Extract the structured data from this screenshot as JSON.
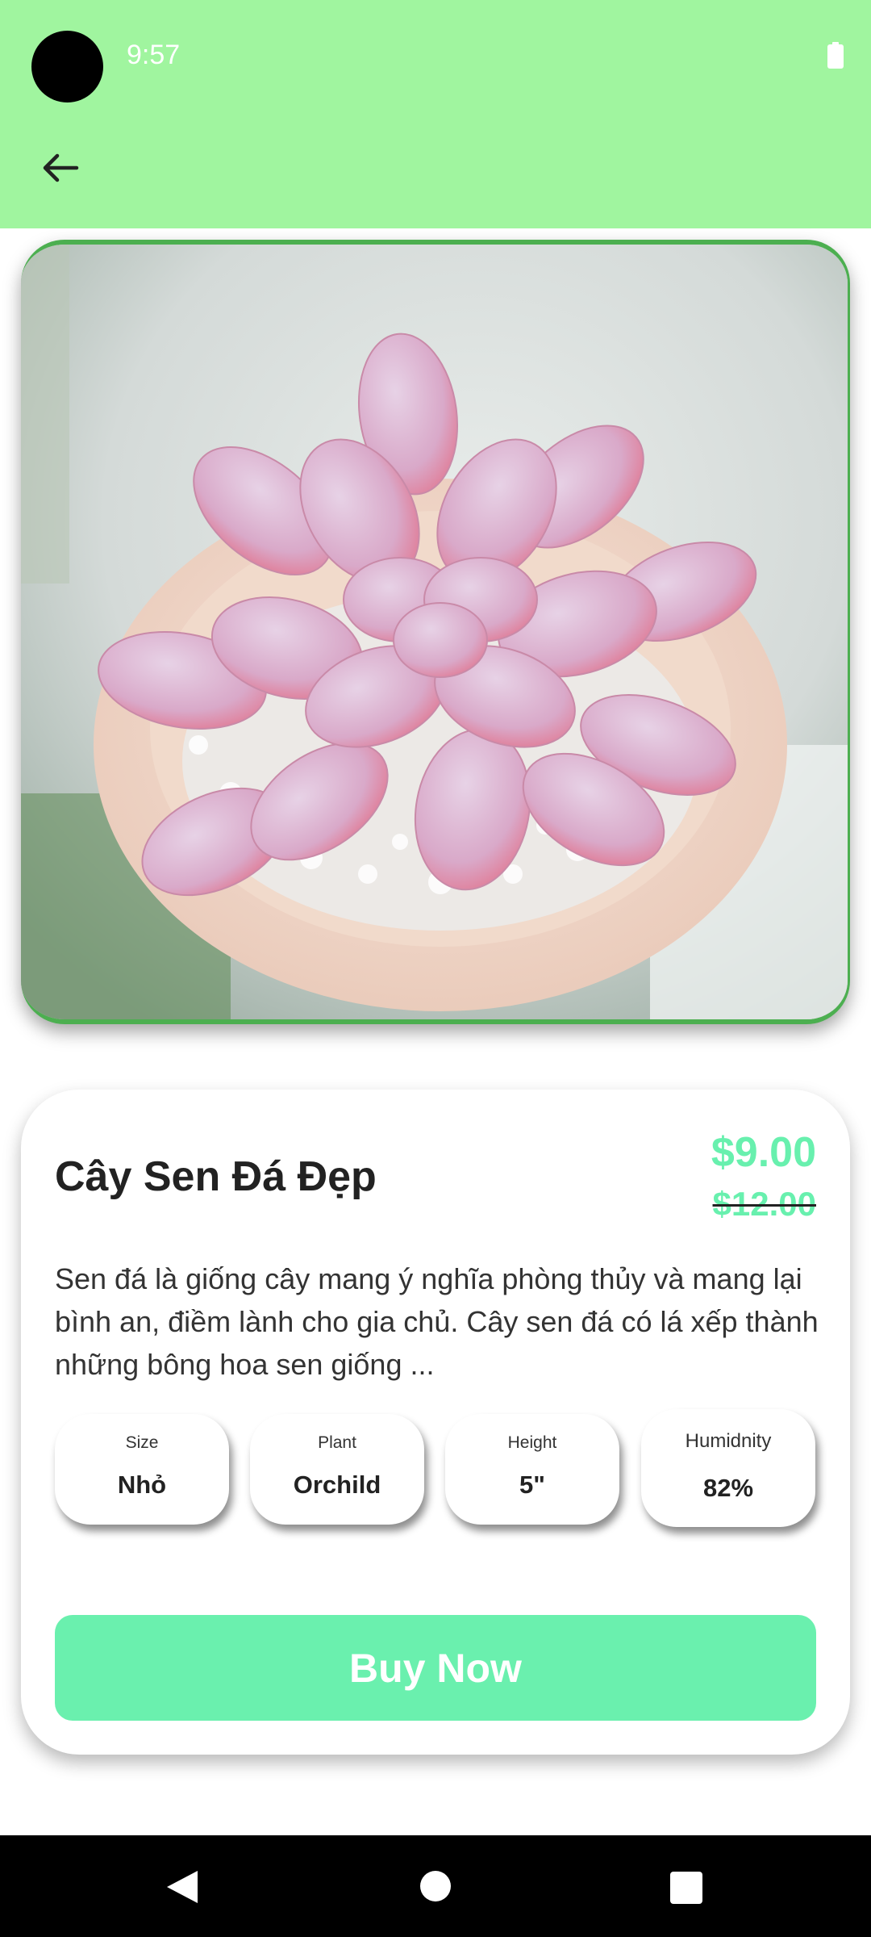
{
  "status_bar": {
    "time": "9:57",
    "icons": [
      "camera-cutout",
      "battery-icon"
    ]
  },
  "app_bar": {
    "back_icon": "arrow-left-icon"
  },
  "product": {
    "image_alt": "pink succulent in pot",
    "name": "Cây Sen Đá Đẹp",
    "price": "$9.00",
    "old_price": "$12.00",
    "description": "Sen đá là giống cây mang ý nghĩa phòng thủy và mang lại bình an, điềm lành cho gia chủ. Cây sen đá có lá xếp thành những bông hoa sen giống ...",
    "attributes": [
      {
        "label": "Size",
        "value": "Nhỏ"
      },
      {
        "label": "Plant",
        "value": "Orchild"
      },
      {
        "label": "Height",
        "value": "5\""
      },
      {
        "label": "Humidnity",
        "value": "82%"
      }
    ],
    "buy_label": "Buy Now"
  },
  "colors": {
    "app_bar": "#a0f59f",
    "accent": "#68f0ae",
    "frame_border": "#4caf50"
  },
  "nav_bar": {
    "icons": [
      "nav-back-icon",
      "nav-home-icon",
      "nav-recents-icon"
    ]
  }
}
